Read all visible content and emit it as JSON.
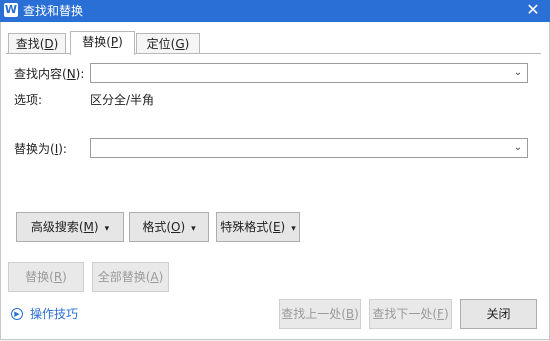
{
  "window": {
    "app_icon": "W",
    "title": "查找和替换",
    "close_glyph": "✕"
  },
  "tabs": [
    {
      "text": "查找(",
      "key": "D",
      "suffix": ")",
      "active": false
    },
    {
      "text": "替换(",
      "key": "P",
      "suffix": ")",
      "active": true
    },
    {
      "text": "定位(",
      "key": "G",
      "suffix": ")",
      "active": false
    }
  ],
  "find": {
    "label_prefix": "查找内容(",
    "label_key": "N",
    "label_suffix": "):",
    "value": ""
  },
  "options": {
    "label": "选项:",
    "value": "区分全/半角"
  },
  "replace": {
    "label_prefix": "替换为(",
    "label_key": "I",
    "label_suffix": "):",
    "value": ""
  },
  "buttons": {
    "advanced": {
      "text": "高级搜索(",
      "key": "M",
      "suffix": ")",
      "caret": "▾"
    },
    "format": {
      "text": "格式(",
      "key": "O",
      "suffix": ")",
      "caret": "▾"
    },
    "special": {
      "text": "特殊格式(",
      "key": "E",
      "suffix": ")",
      "caret": "▾"
    },
    "replace_one": {
      "text": "替换(",
      "key": "R",
      "suffix": ")"
    },
    "replace_all": {
      "text": "全部替换(",
      "key": "A",
      "suffix": ")"
    },
    "find_prev": {
      "text": "查找上一处(",
      "key": "B",
      "suffix": ")"
    },
    "find_next": {
      "text": "查找下一处(",
      "key": "F",
      "suffix": ")"
    },
    "close": {
      "text": "关闭"
    }
  },
  "tips": {
    "label": "操作技巧"
  },
  "colors": {
    "titlebar": "#2a6fd6",
    "link": "#2a6fd6"
  }
}
